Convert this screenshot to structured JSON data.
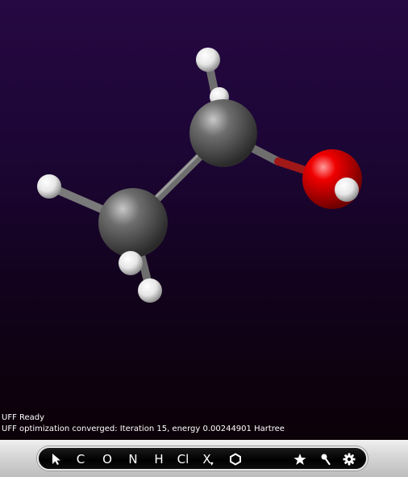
{
  "status": {
    "line1": "UFF Ready",
    "line2": "UFF optimization converged: Iteration 15, energy 0.00244901 Hartree"
  },
  "toolbar": {
    "items": [
      {
        "name": "select-tool-button",
        "icon": "pointer-arrow-icon",
        "label": ""
      },
      {
        "name": "carbon-button",
        "label": "C"
      },
      {
        "name": "oxygen-button",
        "label": "O"
      },
      {
        "name": "nitrogen-button",
        "label": "N"
      },
      {
        "name": "hydrogen-button",
        "label": "H"
      },
      {
        "name": "chlorine-button",
        "label": "Cl"
      },
      {
        "name": "other-element-button",
        "label": "X"
      },
      {
        "name": "ring-button",
        "icon": "hexagon-icon",
        "label": ""
      },
      {
        "name": "favorites-button",
        "icon": "star-icon",
        "label": ""
      },
      {
        "name": "clean-button",
        "icon": "pin-icon",
        "label": ""
      },
      {
        "name": "settings-button",
        "icon": "gear-icon",
        "label": ""
      }
    ]
  },
  "colors": {
    "carbon": "#5a5a5a",
    "oxygen": "#e00000",
    "hydrogen": "#f0f0f0",
    "bond": "#6a6a6a",
    "background_top": "#260842",
    "background_bottom": "#0b0107"
  },
  "molecule": {
    "atoms": [
      {
        "element": "C",
        "label": "C1"
      },
      {
        "element": "C",
        "label": "C2"
      },
      {
        "element": "O",
        "label": "O"
      },
      {
        "element": "H",
        "label": "H1"
      },
      {
        "element": "H",
        "label": "H2"
      },
      {
        "element": "H",
        "label": "H3"
      },
      {
        "element": "H",
        "label": "H4"
      },
      {
        "element": "H",
        "label": "H5"
      },
      {
        "element": "H",
        "label": "H6"
      }
    ]
  }
}
